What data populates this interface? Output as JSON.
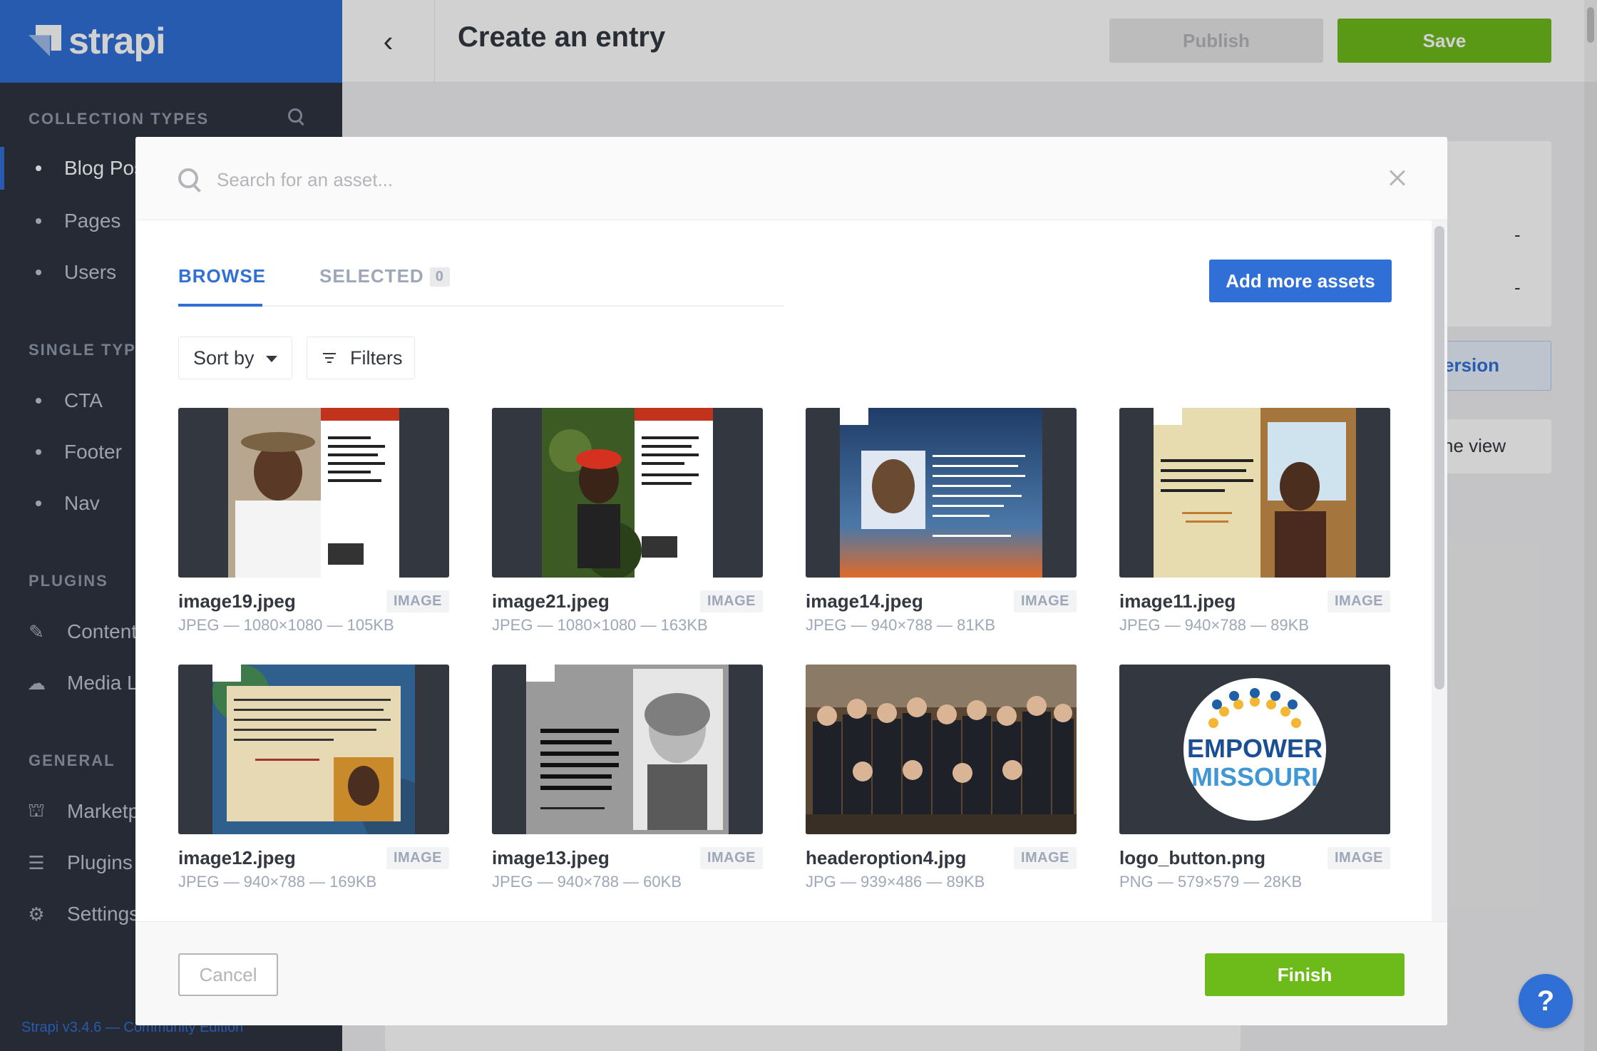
{
  "brand": {
    "name": "strapi"
  },
  "sidebar": {
    "sections": {
      "collection_types": "COLLECTION TYPES",
      "single_types": "SINGLE TYPES",
      "plugins": "PLUGINS",
      "general": "GENERAL"
    },
    "collection_items": [
      {
        "label": "Blog Posts"
      },
      {
        "label": "Pages"
      },
      {
        "label": "Users"
      }
    ],
    "single_items": [
      {
        "label": "CTA"
      },
      {
        "label": "Footer"
      },
      {
        "label": "Nav"
      }
    ],
    "plugin_items": [
      {
        "label": "Content-Types Builder",
        "icon": "paintbrush-icon"
      },
      {
        "label": "Media Library",
        "icon": "cloud-upload-icon"
      }
    ],
    "general_items": [
      {
        "label": "Marketplace",
        "icon": "basket-icon"
      },
      {
        "label": "Plugins",
        "icon": "list-icon"
      },
      {
        "label": "Settings",
        "icon": "gear-icon"
      }
    ],
    "version": "Strapi v3.4.6 — Community Edition"
  },
  "header": {
    "title": "Create an entry",
    "publish_label": "Publish",
    "save_label": "Save"
  },
  "background": {
    "dash1": "-",
    "dash2": "-",
    "version_btn_fragment": "ersion",
    "view_btn_fragment": "ne view"
  },
  "modal": {
    "search_placeholder": "Search for an asset...",
    "tabs": {
      "browse": "BROWSE",
      "selected": "SELECTED",
      "selected_count": "0"
    },
    "add_assets_label": "Add more assets",
    "sort_label": "Sort by",
    "filters_label": "Filters",
    "assets": [
      {
        "name": "image19.jpeg",
        "type": "IMAGE",
        "meta": "JPEG — 1080×1080 — 105KB"
      },
      {
        "name": "image21.jpeg",
        "type": "IMAGE",
        "meta": "JPEG — 1080×1080 — 163KB"
      },
      {
        "name": "image14.jpeg",
        "type": "IMAGE",
        "meta": "JPEG — 940×788 — 81KB"
      },
      {
        "name": "image11.jpeg",
        "type": "IMAGE",
        "meta": "JPEG — 940×788 — 89KB"
      },
      {
        "name": "image12.jpeg",
        "type": "IMAGE",
        "meta": "JPEG — 940×788 — 169KB"
      },
      {
        "name": "image13.jpeg",
        "type": "IMAGE",
        "meta": "JPEG — 940×788 — 60KB"
      },
      {
        "name": "headeroption4.jpg",
        "type": "IMAGE",
        "meta": "JPG — 939×486 — 89KB"
      },
      {
        "name": "logo_button.png",
        "type": "IMAGE",
        "meta": "PNG — 579×579 — 28KB"
      }
    ],
    "logo_text_line1": "EMPOWER",
    "logo_text_line2": "MISSOURI",
    "cancel_label": "Cancel",
    "finish_label": "Finish"
  },
  "help_label": "?",
  "colors": {
    "brand_blue": "#2f6fd6",
    "sidebar_bg": "#2e3440",
    "save_green": "#6dbb1a"
  }
}
